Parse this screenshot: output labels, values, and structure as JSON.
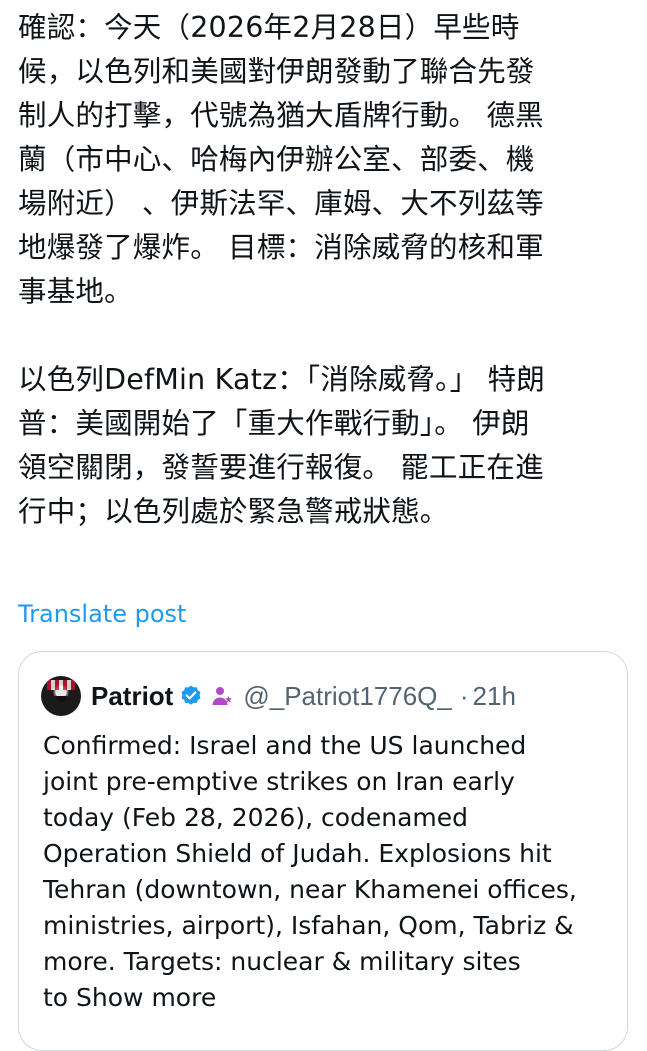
{
  "post": {
    "paragraphs": [
      "確認：今天（2026年2月28日）早些時\n候，以色列和美國對伊朗發動了聯合先發\n制人的打擊，代號為猶大盾牌行動。 德黑\n蘭（市中心、哈梅內伊辦公室、部委、機\n場附近） 、伊斯法罕、庫姆、大不列茲等\n地爆發了爆炸。 目標：消除威脅的核和軍\n事基地。",
      "以色列DefMin Katz：「消除威脅。」 特朗\n普：美國開始了「重大作戰行動」。 伊朗\n領空關閉，發誓要進行報復。 罷工正在進\n行中；以色列處於緊急警戒狀態。"
    ],
    "translate_label": "Translate post"
  },
  "quoted_post": {
    "display_name": "Patriot",
    "handle": "@_Patriot1776Q_",
    "separator": "·",
    "timestamp": "21h",
    "text": "Confirmed: Israel and the US launched\njoint pre-emptive strikes on Iran early\ntoday (Feb 28, 2026), codenamed\nOperation Shield of Judah. Explosions hit\nTehran (downtown, near Khamenei offices,\nministries, airport), Isfahan, Qom, Tabriz &\nmore. Targets: nuclear & military sites\nto ",
    "show_more_label": "Show more",
    "verified_color": "#1d9bf0",
    "affiliate_color": "#b04bc8"
  },
  "colors": {
    "link": "#1d9bf0",
    "secondary_text": "#536471",
    "border": "#cfd9de"
  }
}
